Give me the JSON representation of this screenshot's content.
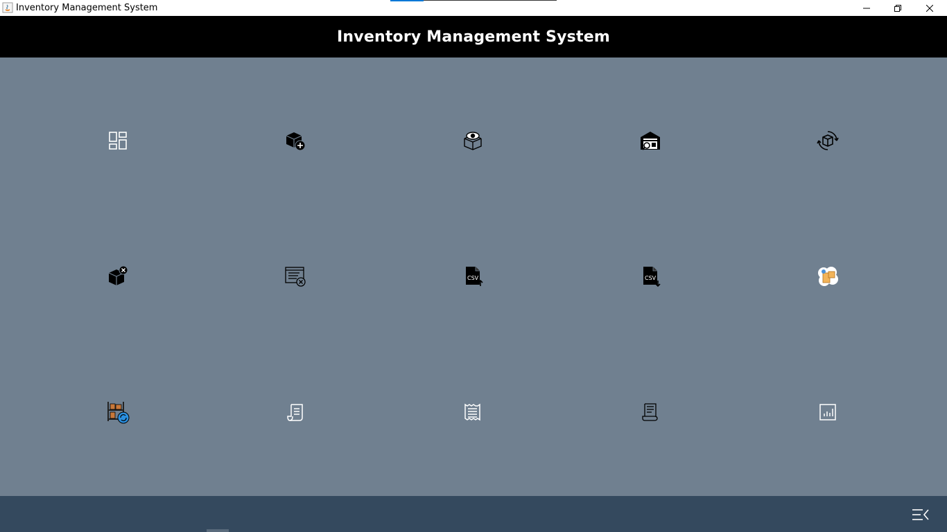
{
  "window": {
    "title": "Inventory Management System",
    "controls": [
      "minimize-icon",
      "restore-icon",
      "close-icon"
    ]
  },
  "header": {
    "title": "Inventory Management System"
  },
  "colors": {
    "header_bg": "#000000",
    "content_bg": "#708090",
    "footer_bg": "#34495e",
    "icon_light": "#ffffff",
    "icon_dark": "#000000"
  },
  "tiles": [
    {
      "icon": "dashboard-icon"
    },
    {
      "icon": "add-product-icon"
    },
    {
      "icon": "view-product-icon"
    },
    {
      "icon": "warehouse-search-icon"
    },
    {
      "icon": "update-product-icon"
    },
    {
      "icon": "delete-product-icon"
    },
    {
      "icon": "delete-record-icon"
    },
    {
      "icon": "csv-export-icon"
    },
    {
      "icon": "csv-import-icon"
    },
    {
      "icon": "supplier-package-icon"
    },
    {
      "icon": "stock-refresh-icon"
    },
    {
      "icon": "receipt-icon"
    },
    {
      "icon": "invoice-icon"
    },
    {
      "icon": "report-scroll-icon"
    },
    {
      "icon": "statistics-chart-icon"
    }
  ],
  "footer": {
    "menu_icon": "collapse-menu-icon"
  }
}
